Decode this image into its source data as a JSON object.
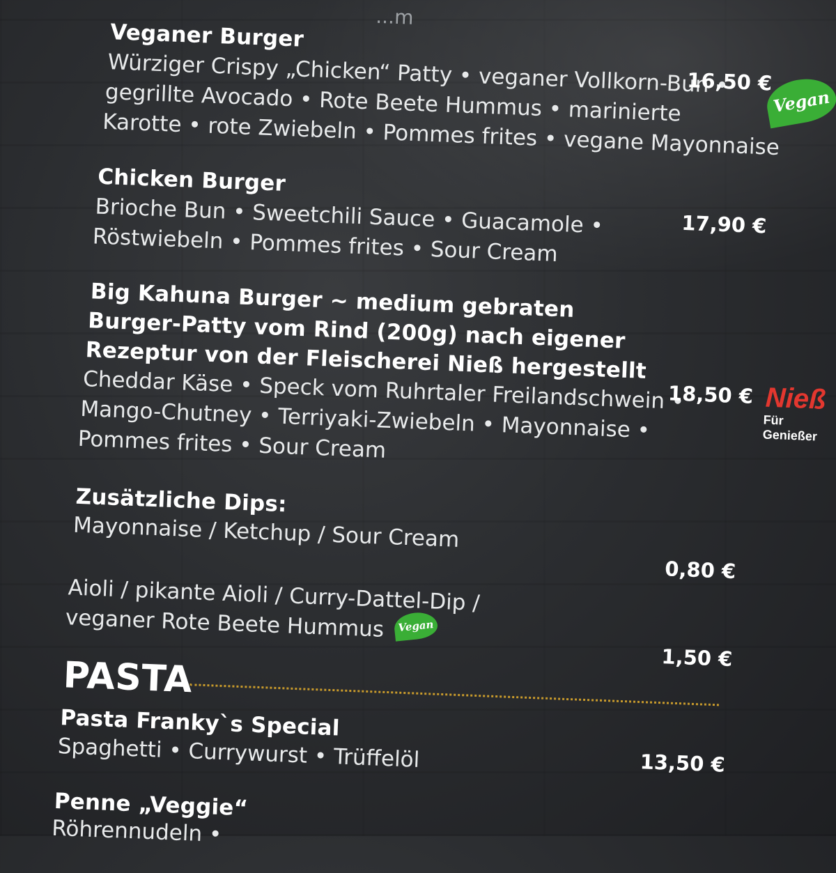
{
  "top_fragment": "...m",
  "items": [
    {
      "title": "Veganer Burger",
      "desc": [
        "Würziger Crispy „Chicken“ Patty • veganer Vollkorn-Bun •",
        "gegrillte Avocado • Rote Beete Hummus • marinierte",
        "Karotte • rote Zwiebeln • Pommes frites • vegane Mayonnaise"
      ],
      "price": "16,50 €",
      "badge": "Vegan"
    },
    {
      "title": "Chicken Burger",
      "desc": [
        "Brioche Bun • Sweetchili Sauce • Guacamole •",
        "Röstwiebeln • Pommes frites • Sour Cream"
      ],
      "price": "17,90 €"
    },
    {
      "title_lines": [
        "Big Kahuna Burger ~ medium gebraten",
        "Burger-Patty vom Rind (200g) nach eigener",
        "Rezeptur von der Fleischerei Nieß hergestellt"
      ],
      "desc": [
        "Cheddar Käse • Speck vom Ruhrtaler Freilandschwein •",
        "Mango-Chutney • Terriyaki-Zwiebeln • Mayonnaise •",
        "Pommes frites • Sour Cream"
      ],
      "price": "18,50 €",
      "logo": {
        "name": "Nieß",
        "tagline": "Für Genießer"
      }
    }
  ],
  "dips": {
    "title": "Zusätzliche Dips:",
    "group1": {
      "desc": "Mayonnaise / Ketchup / Sour Cream",
      "price": "0,80 €"
    },
    "group2": {
      "desc": [
        "Aioli / pikante Aioli / Curry-Dattel-Dip /",
        "veganer Rote Beete Hummus"
      ],
      "badge": "Vegan",
      "price": "1,50 €"
    }
  },
  "pasta": {
    "section_title": "PASTA",
    "items": [
      {
        "title": "Pasta Franky`s Special",
        "desc": "Spaghetti • Currywurst • Trüffelöl",
        "price": "13,50 €"
      },
      {
        "title": "Penne „Veggie“",
        "desc": "Röhrennudeln •"
      }
    ]
  },
  "colors": {
    "background": "#2b2d30",
    "text": "#eef0f1",
    "vegan_green": "#3aae36",
    "niess_red": "#e3372f",
    "divider_gold": "#c99b2c"
  }
}
